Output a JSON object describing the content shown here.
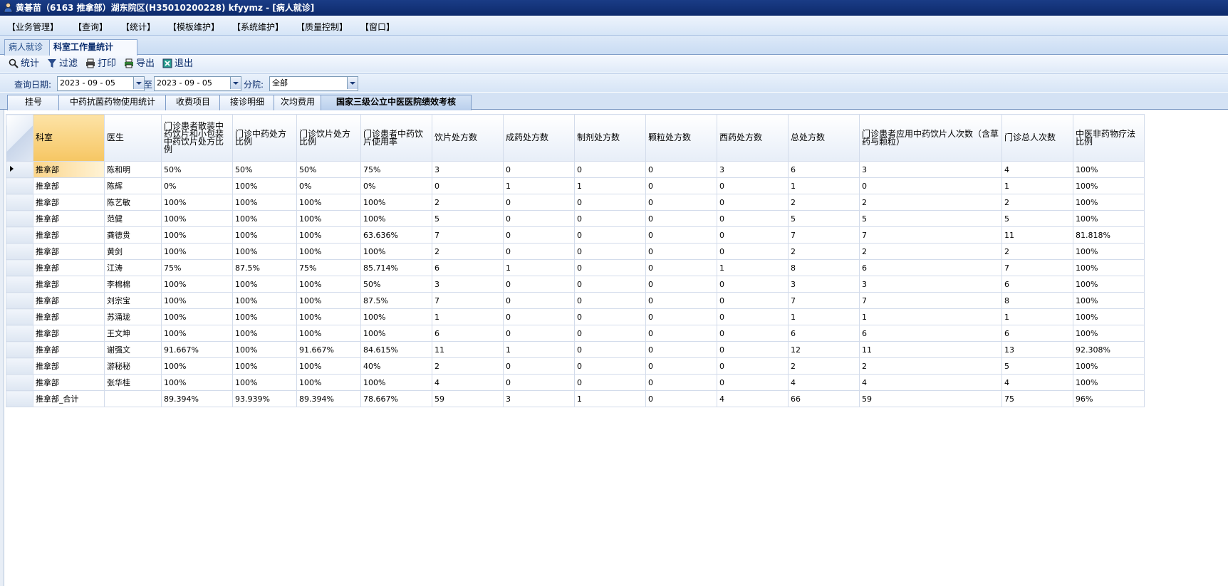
{
  "window": {
    "title": "黄碁苗（6163 推拿部）湖东院区(H35010200228) kfyymz - [病人就诊]"
  },
  "menu": [
    "【业务管理】",
    "【查询】",
    "【统计】",
    "【模板维护】",
    "【系统维护】",
    "【质量控制】",
    "【窗口】"
  ],
  "doc_tabs": [
    {
      "label": "病人就诊",
      "active": false
    },
    {
      "label": "科室工作量统计",
      "active": true
    }
  ],
  "toolbar": {
    "stats": "统计",
    "filter": "过滤",
    "print": "打印",
    "export": "导出",
    "exit": "退出"
  },
  "filters": {
    "date_label": "查询日期:",
    "date_from": "2023 - 09 - 05",
    "to_label": "至",
    "date_to": "2023 - 09 - 05",
    "branch_label": "分院:",
    "branch_value": "全部"
  },
  "report_tabs": [
    {
      "label": "挂号",
      "active": false
    },
    {
      "label": "中药抗菌药物使用统计",
      "active": false
    },
    {
      "label": "收费项目",
      "active": false
    },
    {
      "label": "接诊明细",
      "active": false
    },
    {
      "label": "次均费用",
      "active": false
    },
    {
      "label": "国家三级公立中医医院绩效考核",
      "active": true
    }
  ],
  "grid": {
    "columns": [
      "科室",
      "医生",
      "门诊患者散装中药饮片和小包装中药饮片处方比例",
      "门诊中药处方比例",
      "门诊饮片处方比例",
      "门诊患者中药饮片使用率",
      "饮片处方数",
      "成药处方数",
      "制剂处方数",
      "颗粒处方数",
      "西药处方数",
      "总处方数",
      "门诊患者应用中药饮片人次数（含草药与颗粒）",
      "门诊总人次数",
      "中医非药物疗法比例"
    ],
    "rows": [
      [
        "推拿部",
        "陈和明",
        "50%",
        "50%",
        "50%",
        "75%",
        "3",
        "0",
        "0",
        "0",
        "3",
        "6",
        "3",
        "4",
        "100%"
      ],
      [
        "推拿部",
        "陈辉",
        "0%",
        "100%",
        "0%",
        "0%",
        "0",
        "1",
        "1",
        "0",
        "0",
        "1",
        "0",
        "1",
        "100%"
      ],
      [
        "推拿部",
        "陈艺敏",
        "100%",
        "100%",
        "100%",
        "100%",
        "2",
        "0",
        "0",
        "0",
        "0",
        "2",
        "2",
        "2",
        "100%"
      ],
      [
        "推拿部",
        "范健",
        "100%",
        "100%",
        "100%",
        "100%",
        "5",
        "0",
        "0",
        "0",
        "0",
        "5",
        "5",
        "5",
        "100%"
      ],
      [
        "推拿部",
        "龚德贵",
        "100%",
        "100%",
        "100%",
        "63.636%",
        "7",
        "0",
        "0",
        "0",
        "0",
        "7",
        "7",
        "11",
        "81.818%"
      ],
      [
        "推拿部",
        "黄剑",
        "100%",
        "100%",
        "100%",
        "100%",
        "2",
        "0",
        "0",
        "0",
        "0",
        "2",
        "2",
        "2",
        "100%"
      ],
      [
        "推拿部",
        "江涛",
        "75%",
        "87.5%",
        "75%",
        "85.714%",
        "6",
        "1",
        "0",
        "0",
        "1",
        "8",
        "6",
        "7",
        "100%"
      ],
      [
        "推拿部",
        "李棉棉",
        "100%",
        "100%",
        "100%",
        "50%",
        "3",
        "0",
        "0",
        "0",
        "0",
        "3",
        "3",
        "6",
        "100%"
      ],
      [
        "推拿部",
        "刘宗宝",
        "100%",
        "100%",
        "100%",
        "87.5%",
        "7",
        "0",
        "0",
        "0",
        "0",
        "7",
        "7",
        "8",
        "100%"
      ],
      [
        "推拿部",
        "苏涌珑",
        "100%",
        "100%",
        "100%",
        "100%",
        "1",
        "0",
        "0",
        "0",
        "0",
        "1",
        "1",
        "1",
        "100%"
      ],
      [
        "推拿部",
        "王文坤",
        "100%",
        "100%",
        "100%",
        "100%",
        "6",
        "0",
        "0",
        "0",
        "0",
        "6",
        "6",
        "6",
        "100%"
      ],
      [
        "推拿部",
        "谢强文",
        "91.667%",
        "100%",
        "91.667%",
        "84.615%",
        "11",
        "1",
        "0",
        "0",
        "0",
        "12",
        "11",
        "13",
        "92.308%"
      ],
      [
        "推拿部",
        "游秘秘",
        "100%",
        "100%",
        "100%",
        "40%",
        "2",
        "0",
        "0",
        "0",
        "0",
        "2",
        "2",
        "5",
        "100%"
      ],
      [
        "推拿部",
        "张华桂",
        "100%",
        "100%",
        "100%",
        "100%",
        "4",
        "0",
        "0",
        "0",
        "0",
        "4",
        "4",
        "4",
        "100%"
      ],
      [
        "推拿部_合计",
        "",
        "89.394%",
        "93.939%",
        "89.394%",
        "78.667%",
        "59",
        "3",
        "1",
        "0",
        "4",
        "66",
        "59",
        "75",
        "96%"
      ]
    ]
  }
}
